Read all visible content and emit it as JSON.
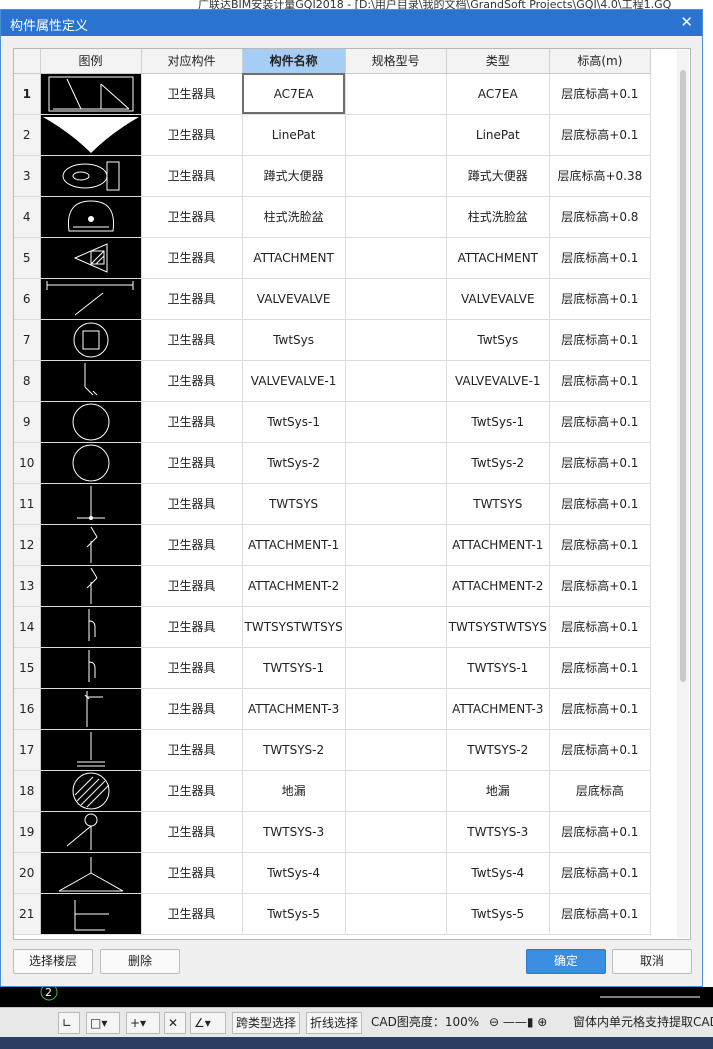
{
  "background_window_title": "广联达BIM安装计量GQI2018 - [D:\\用户目录\\我的文档\\GrandSoft Projects\\GQI\\4.0\\工程1.GQ",
  "dialog": {
    "title": "构件属性定义",
    "close_glyph": "✕"
  },
  "table": {
    "columns": [
      "图例",
      "对应构件",
      "构件名称",
      "规格型号",
      "类型",
      "标高(m)"
    ],
    "rows": [
      {
        "n": "1",
        "comp": "卫生器具",
        "name": "AC7EA",
        "spec": "",
        "type": "AC7EA",
        "elev": "层底标高+0.1",
        "icon": "washbasin-sketch"
      },
      {
        "n": "2",
        "comp": "卫生器具",
        "name": "LinePat",
        "spec": "",
        "type": "LinePat",
        "elev": "层底标高+0.1",
        "icon": "funnel"
      },
      {
        "n": "3",
        "comp": "卫生器具",
        "name": "蹲式大便器",
        "spec": "",
        "type": "蹲式大便器",
        "elev": "层底标高+0.38",
        "icon": "toilet"
      },
      {
        "n": "4",
        "comp": "卫生器具",
        "name": "柱式洗脸盆",
        "spec": "",
        "type": "柱式洗脸盆",
        "elev": "层底标高+0.8",
        "icon": "pedestal-basin"
      },
      {
        "n": "5",
        "comp": "卫生器具",
        "name": "ATTACHMENT",
        "spec": "",
        "type": "ATTACHMENT",
        "elev": "层底标高+0.1",
        "icon": "triangle-hatch"
      },
      {
        "n": "6",
        "comp": "卫生器具",
        "name": "VALVEVALVE",
        "spec": "",
        "type": "VALVEVALVE",
        "elev": "层底标高+0.1",
        "icon": "valve-bar"
      },
      {
        "n": "7",
        "comp": "卫生器具",
        "name": "TwtSys",
        "spec": "",
        "type": "TwtSys",
        "elev": "层底标高+0.1",
        "icon": "circle-square"
      },
      {
        "n": "8",
        "comp": "卫生器具",
        "name": "VALVEVALVE-1",
        "spec": "",
        "type": "VALVEVALVE-1",
        "elev": "层底标高+0.1",
        "icon": "pipe-bend"
      },
      {
        "n": "9",
        "comp": "卫生器具",
        "name": "TwtSys-1",
        "spec": "",
        "type": "TwtSys-1",
        "elev": "层底标高+0.1",
        "icon": "circle"
      },
      {
        "n": "10",
        "comp": "卫生器具",
        "name": "TwtSys-2",
        "spec": "",
        "type": "TwtSys-2",
        "elev": "层底标高+0.1",
        "icon": "circle"
      },
      {
        "n": "11",
        "comp": "卫生器具",
        "name": "TWTSYS",
        "spec": "",
        "type": "TWTSYS",
        "elev": "层底标高+0.1",
        "icon": "pipe-tee"
      },
      {
        "n": "12",
        "comp": "卫生器具",
        "name": "ATTACHMENT-1",
        "spec": "",
        "type": "ATTACHMENT-1",
        "elev": "层底标高+0.1",
        "icon": "pipe-slant"
      },
      {
        "n": "13",
        "comp": "卫生器具",
        "name": "ATTACHMENT-2",
        "spec": "",
        "type": "ATTACHMENT-2",
        "elev": "层底标高+0.1",
        "icon": "pipe-slant"
      },
      {
        "n": "14",
        "comp": "卫生器具",
        "name": "TWTSYSTWTSYS",
        "spec": "",
        "type": "TWTSYSTWTSYS",
        "elev": "层底标高+0.1",
        "icon": "pipe-hook"
      },
      {
        "n": "15",
        "comp": "卫生器具",
        "name": "TWTSYS-1",
        "spec": "",
        "type": "TWTSYS-1",
        "elev": "层底标高+0.1",
        "icon": "pipe-hook"
      },
      {
        "n": "16",
        "comp": "卫生器具",
        "name": "ATTACHMENT-3",
        "spec": "",
        "type": "ATTACHMENT-3",
        "elev": "层底标高+0.1",
        "icon": "pipe-l"
      },
      {
        "n": "17",
        "comp": "卫生器具",
        "name": "TWTSYS-2",
        "spec": "",
        "type": "TWTSYS-2",
        "elev": "层底标高+0.1",
        "icon": "pipe-base"
      },
      {
        "n": "18",
        "comp": "卫生器具",
        "name": "地漏",
        "spec": "",
        "type": "地漏",
        "elev": "层底标高",
        "icon": "floor-drain"
      },
      {
        "n": "19",
        "comp": "卫生器具",
        "name": "TWTSYS-3",
        "spec": "",
        "type": "TWTSYS-3",
        "elev": "层底标高+0.1",
        "icon": "cone"
      },
      {
        "n": "20",
        "comp": "卫生器具",
        "name": "TwtSys-4",
        "spec": "",
        "type": "TwtSys-4",
        "elev": "层底标高+0.1",
        "icon": "tripod"
      },
      {
        "n": "21",
        "comp": "卫生器具",
        "name": "TwtSys-5",
        "spec": "",
        "type": "TwtSys-5",
        "elev": "层底标高+0.1",
        "icon": "pipe-t"
      }
    ]
  },
  "buttons": {
    "select_floor": "选择楼层",
    "delete": "删除",
    "ok": "确定",
    "cancel": "取消"
  },
  "cad_canvas": {
    "marker": "2"
  },
  "statusbar": {
    "cross_type_select": "跨类型选择",
    "polyline_select": "折线选择",
    "cad_brightness": "CAD图亮度：100%",
    "hint": "窗体内单元格支持提取CAD"
  }
}
